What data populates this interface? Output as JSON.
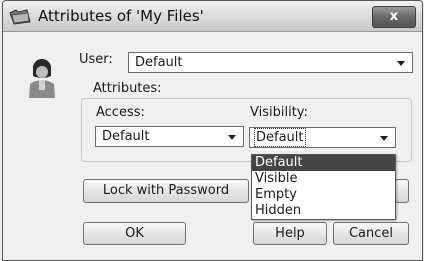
{
  "window": {
    "title": "Attributes of 'My Files'",
    "close_label": "x"
  },
  "user": {
    "label": "User:",
    "value": "Default"
  },
  "attributes": {
    "group_label": "Attributes:",
    "access": {
      "label": "Access:",
      "value": "Default"
    },
    "visibility": {
      "label": "Visibility:",
      "value": "Default",
      "options": [
        "Default",
        "Visible",
        "Empty",
        "Hidden"
      ],
      "highlighted": "Default"
    }
  },
  "buttons": {
    "lock_password": "Lock with Password",
    "ok": "OK",
    "help": "Help",
    "cancel": "Cancel"
  },
  "icons": {
    "title": "folder-icon",
    "avatar": "user-avatar-icon",
    "close": "close-icon",
    "dropdown": "chevron-down-icon"
  }
}
